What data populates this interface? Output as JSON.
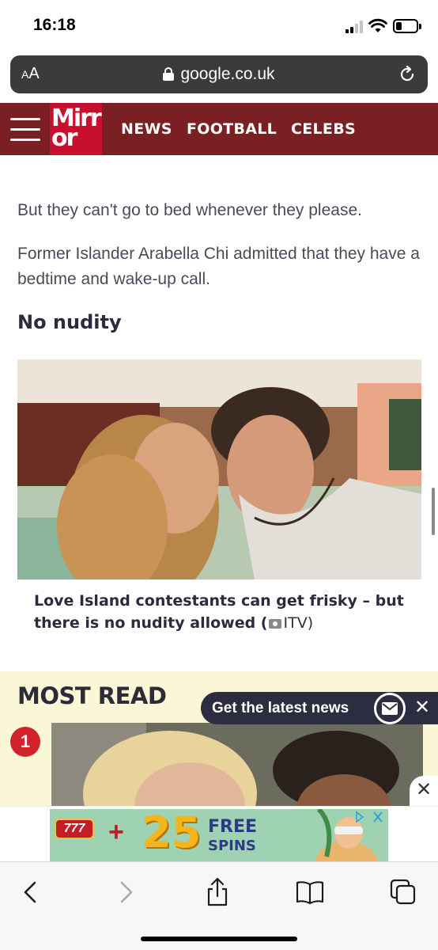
{
  "status_bar": {
    "time": "16:18"
  },
  "browser": {
    "aa_label_small": "A",
    "aa_label_big": "A",
    "url": "google.co.uk"
  },
  "site": {
    "logo_line1": "Mirr",
    "logo_line2": "or",
    "nav": [
      "NEWS",
      "FOOTBALL",
      "CELEBS"
    ],
    "brand_color": "#c8102e",
    "header_color": "#7a1f22"
  },
  "article": {
    "para1": "But they can't go to bed whenever they please.",
    "para2": "Former Islander Arabella Chi admitted that they have a bedtime and wake-up call.",
    "subheading": "No nudity",
    "caption": "Love Island contestants can get frisky – but there is no nudity allowed (",
    "caption_credit": "ITV)"
  },
  "most_read": {
    "title": "MOST READ",
    "rank": "1",
    "background": "#fbf6d5"
  },
  "notification": {
    "text": "Get the latest news",
    "close": "✕"
  },
  "ad": {
    "close": "✕",
    "slot_label": "777",
    "plus": "+",
    "amount": "25",
    "free": "FREE",
    "spins": "SPINS"
  },
  "toolbar": {
    "icons": [
      "back-icon",
      "forward-icon",
      "share-icon",
      "bookmarks-icon",
      "tabs-icon"
    ]
  }
}
